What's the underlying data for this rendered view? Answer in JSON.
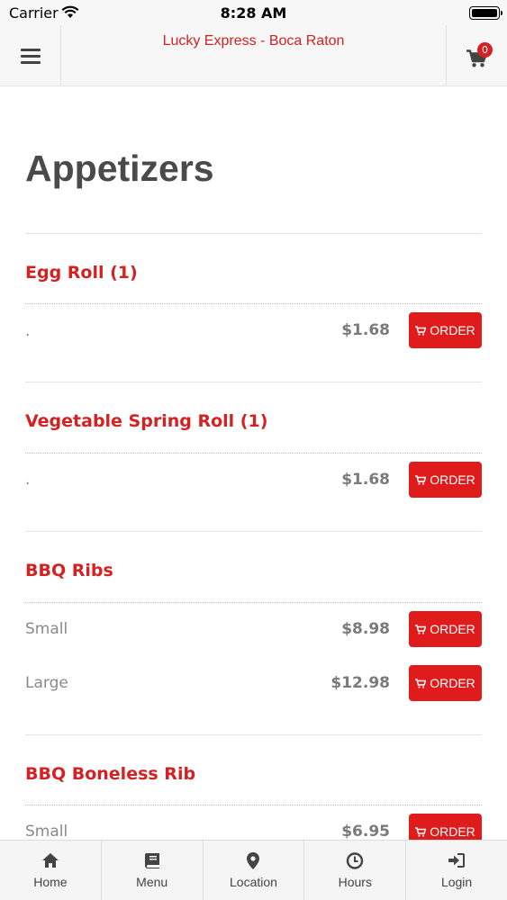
{
  "status_bar": {
    "carrier": "Carrier",
    "time": "8:28 AM"
  },
  "header": {
    "title": "Lucky Express - Boca Raton",
    "cart_count": "0"
  },
  "page": {
    "title": "Appetizers"
  },
  "items": [
    {
      "name": "Egg Roll (1)",
      "options": [
        {
          "label": ".",
          "price": "$1.68",
          "button": "ORDER"
        }
      ]
    },
    {
      "name": "Vegetable Spring Roll (1)",
      "options": [
        {
          "label": ".",
          "price": "$1.68",
          "button": "ORDER"
        }
      ]
    },
    {
      "name": "BBQ Ribs",
      "options": [
        {
          "label": "Small",
          "price": "$8.98",
          "button": "ORDER"
        },
        {
          "label": "Large",
          "price": "$12.98",
          "button": "ORDER"
        }
      ]
    },
    {
      "name": "BBQ Boneless Rib",
      "options": [
        {
          "label": "Small",
          "price": "$6.95",
          "button": "ORDER"
        }
      ]
    }
  ],
  "nav": [
    {
      "label": "Home",
      "icon": "home-icon"
    },
    {
      "label": "Menu",
      "icon": "book-icon"
    },
    {
      "label": "Location",
      "icon": "map-pin-icon"
    },
    {
      "label": "Hours",
      "icon": "clock-icon"
    },
    {
      "label": "Login",
      "icon": "sign-in-icon"
    }
  ],
  "colors": {
    "accent": "#d42121",
    "button": "#e01b1b",
    "header_bg": "#f7f7f7"
  }
}
